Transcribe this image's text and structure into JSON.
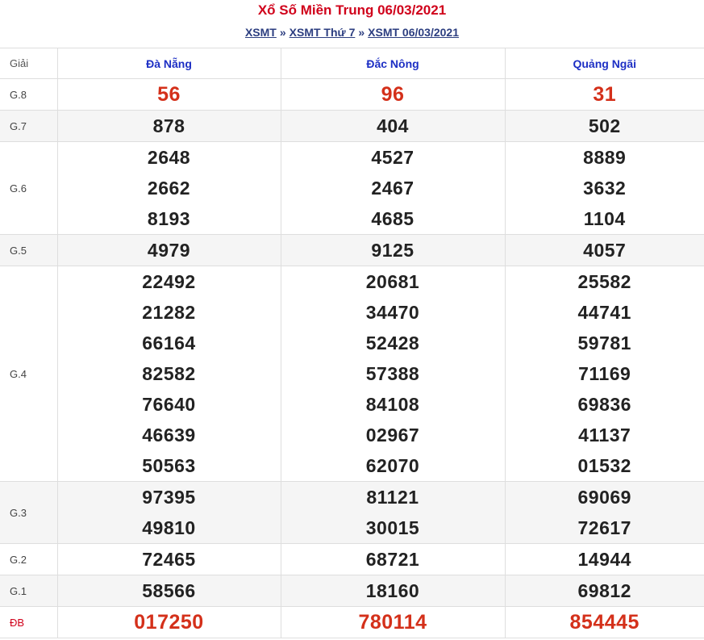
{
  "header": {
    "title": "Xổ Số Miền Trung 06/03/2021",
    "breadcrumb": [
      "XSMT",
      "XSMT Thứ 7",
      "XSMT 06/03/2021"
    ],
    "separator": "»"
  },
  "table": {
    "col_header_label": "Giải",
    "provinces": [
      "Đà Nẵng",
      "Đắc Nông",
      "Quảng Ngãi"
    ],
    "rows": [
      {
        "prize": "G.8",
        "red": true,
        "values": [
          [
            "56"
          ],
          [
            "96"
          ],
          [
            "31"
          ]
        ]
      },
      {
        "prize": "G.7",
        "red": false,
        "values": [
          [
            "878"
          ],
          [
            "404"
          ],
          [
            "502"
          ]
        ]
      },
      {
        "prize": "G.6",
        "red": false,
        "values": [
          [
            "2648",
            "2662",
            "8193"
          ],
          [
            "4527",
            "2467",
            "4685"
          ],
          [
            "8889",
            "3632",
            "1104"
          ]
        ]
      },
      {
        "prize": "G.5",
        "red": false,
        "values": [
          [
            "4979"
          ],
          [
            "9125"
          ],
          [
            "4057"
          ]
        ]
      },
      {
        "prize": "G.4",
        "red": false,
        "values": [
          [
            "22492",
            "21282",
            "66164",
            "82582",
            "76640",
            "46639",
            "50563"
          ],
          [
            "20681",
            "34470",
            "52428",
            "57388",
            "84108",
            "02967",
            "62070"
          ],
          [
            "25582",
            "44741",
            "59781",
            "71169",
            "69836",
            "41137",
            "01532"
          ]
        ]
      },
      {
        "prize": "G.3",
        "red": false,
        "values": [
          [
            "97395",
            "49810"
          ],
          [
            "81121",
            "30015"
          ],
          [
            "69069",
            "72617"
          ]
        ]
      },
      {
        "prize": "G.2",
        "red": false,
        "values": [
          [
            "72465"
          ],
          [
            "68721"
          ],
          [
            "14944"
          ]
        ]
      },
      {
        "prize": "G.1",
        "red": false,
        "values": [
          [
            "58566"
          ],
          [
            "18160"
          ],
          [
            "69812"
          ]
        ]
      },
      {
        "prize": "ĐB",
        "red": true,
        "values": [
          [
            "017250"
          ],
          [
            "780114"
          ],
          [
            "854445"
          ]
        ]
      }
    ]
  },
  "colors": {
    "title": "#d0021b",
    "province": "#1d2fc4",
    "red_number": "#d4301a",
    "alt_row": "#f5f5f5"
  }
}
